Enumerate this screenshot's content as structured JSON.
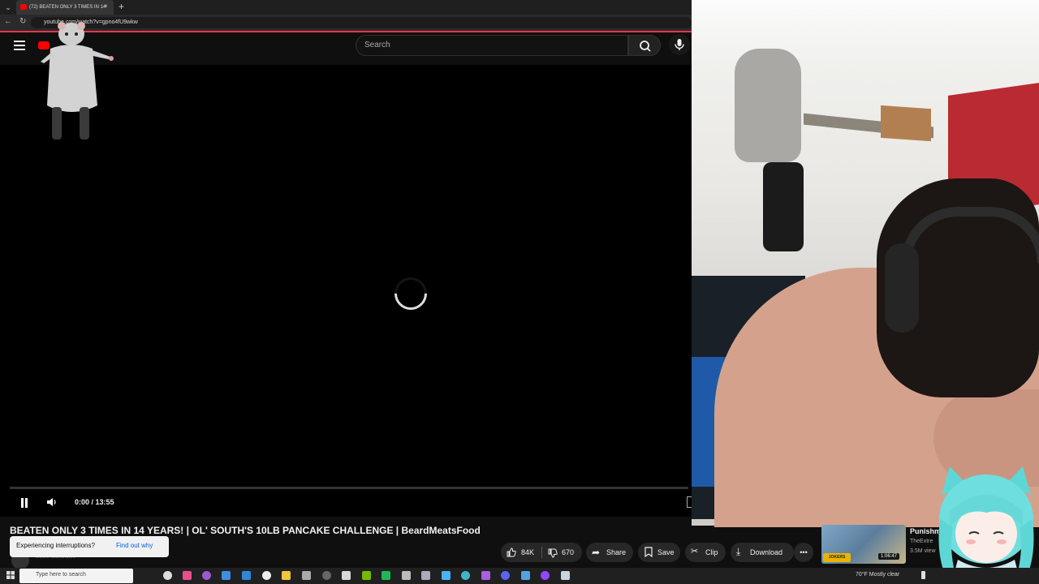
{
  "browser": {
    "tab_title": "(72) BEATEN ONLY 3 TIMES IN 14",
    "tab_close": "×",
    "new_tab": "+",
    "tab_menu": "⌄",
    "url": "youtube.com/watch?v=gpno4fU9wkw"
  },
  "youtube": {
    "search_placeholder": "Search"
  },
  "player": {
    "time": "0:00 / 13:55"
  },
  "video": {
    "title": "BEATEN ONLY 3 TIMES IN 14 YEARS! | OL' SOUTH'S 10LB PANCAKE CHALLENGE | BeardMeatsFood",
    "subscribers": "6.56M subscribers"
  },
  "toast": {
    "text": "Experiencing interruptions?",
    "link": "Find out why"
  },
  "actions": {
    "likes": "84K",
    "dislikes": "670",
    "share": "Share",
    "save": "Save",
    "clip": "Clip",
    "download": "Download",
    "more": "•••"
  },
  "suggested": {
    "title": "Punishm",
    "channel": "TheExtre",
    "views": "3.5M view",
    "duration": "1:06:47",
    "badge": "JOKERS"
  },
  "taskbar": {
    "search_placeholder": "Type here to search",
    "weather": "70°F  Mostly clear"
  },
  "colors": {
    "accent_red": "#ff0000",
    "link_blue": "#065fd4",
    "page_bg": "#0f0f0f"
  }
}
